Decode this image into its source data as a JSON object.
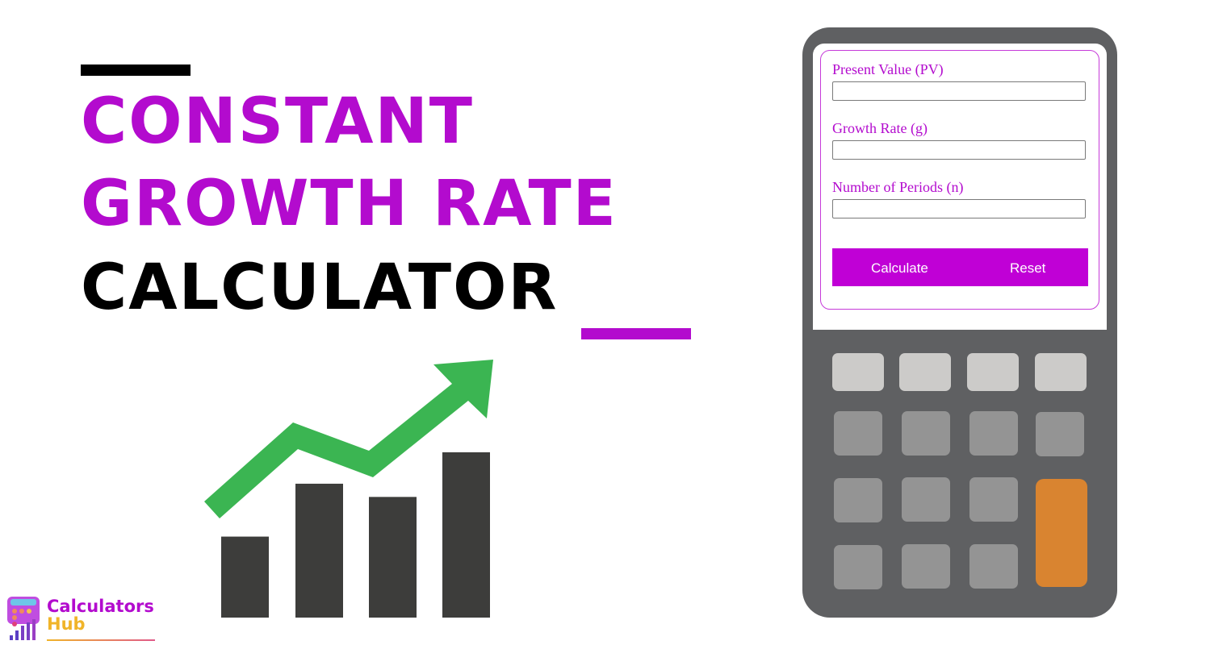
{
  "headline": {
    "line1": "Constant",
    "line2": "Growth Rate",
    "line3": "Calculator"
  },
  "colors": {
    "accent": "#b30bce",
    "button": "#c000d6",
    "arrow": "#3bb552",
    "bars": "#3d3d3b",
    "calculator_body": "#5f6062",
    "orange_key": "#d98430"
  },
  "illustration": {
    "icon": "growth-chart-icon",
    "relative_bar_heights": [
      0.49,
      0.81,
      0.73,
      1.0
    ]
  },
  "calculator_form": {
    "fields": [
      {
        "label": "Present Value (PV)",
        "value": "",
        "placeholder": ""
      },
      {
        "label": "Growth Rate (g)",
        "value": "",
        "placeholder": ""
      },
      {
        "label": "Number of Periods (n)",
        "value": "",
        "placeholder": ""
      }
    ],
    "buttons": {
      "calculate": "Calculate",
      "reset": "Reset"
    }
  },
  "logo": {
    "line1": "Calculators",
    "line2": "Hub",
    "icon": "calculator-logo-icon"
  }
}
